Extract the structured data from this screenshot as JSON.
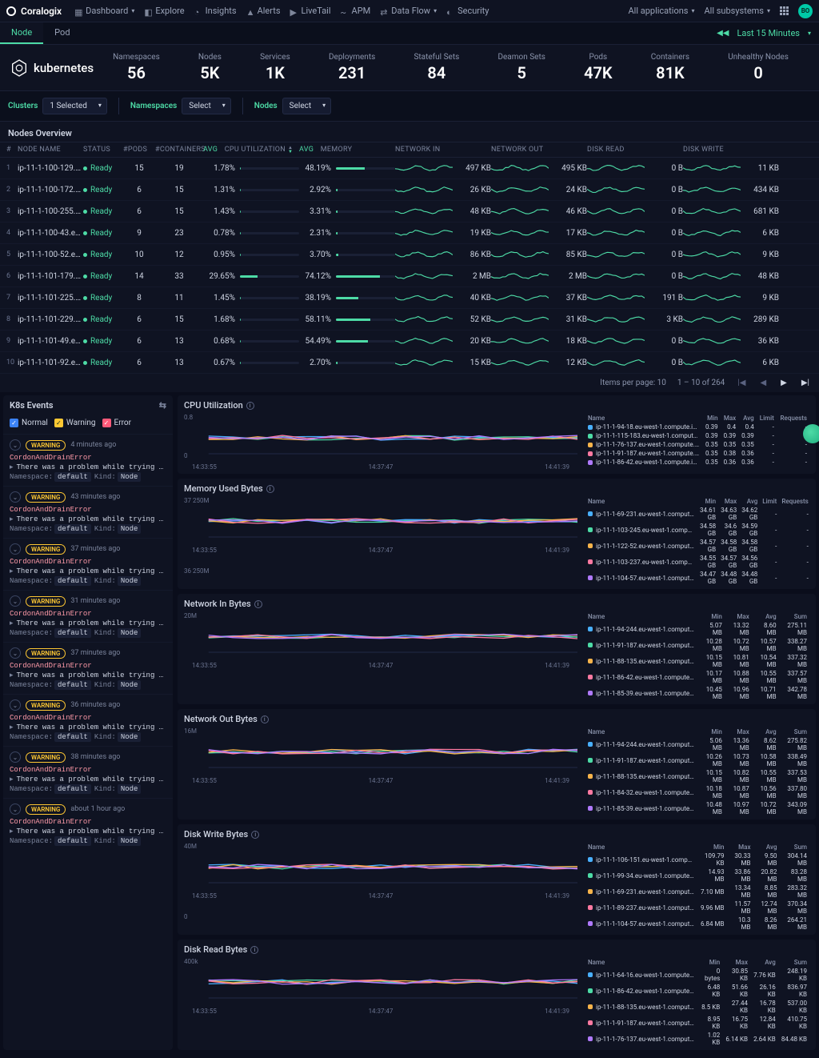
{
  "brand": "Coralogix",
  "nav": [
    {
      "label": "Dashboard",
      "caret": true
    },
    {
      "label": "Explore"
    },
    {
      "label": "Insights"
    },
    {
      "label": "Alerts"
    },
    {
      "label": "LiveTail"
    },
    {
      "label": "APM"
    },
    {
      "label": "Data Flow",
      "caret": true
    },
    {
      "label": "Security"
    }
  ],
  "nav_right": {
    "apps": "All applications",
    "subs": "All subsystems",
    "avatar": "BO"
  },
  "tabs": {
    "node": "Node",
    "pod": "Pod",
    "range": "Last 15 Minutes"
  },
  "product": "kubernetes",
  "stats": [
    {
      "label": "Namespaces",
      "value": "56"
    },
    {
      "label": "Nodes",
      "value": "5K"
    },
    {
      "label": "Services",
      "value": "1K"
    },
    {
      "label": "Deployments",
      "value": "231"
    },
    {
      "label": "Stateful Sets",
      "value": "84"
    },
    {
      "label": "Deamon Sets",
      "value": "5"
    },
    {
      "label": "Pods",
      "value": "47K"
    },
    {
      "label": "Containers",
      "value": "81K"
    },
    {
      "label": "Unhealthy Nodes",
      "value": "0"
    }
  ],
  "filters": {
    "clusters_label": "Clusters",
    "clusters_value": "1 Selected",
    "namespaces_label": "Namespaces",
    "namespaces_value": "Select",
    "nodes_label": "Nodes",
    "nodes_value": "Select"
  },
  "overview_title": "Nodes Overview",
  "columns": {
    "idx": "#",
    "name": "NODE NAME",
    "status": "STATUS",
    "pods": "#PODS",
    "cont": "#CONTAINERS",
    "cpu": "CPU UTILIZATION",
    "mem": "MEMORY",
    "avg": "AVG",
    "nin": "NETWORK IN",
    "nout": "NETWORK OUT",
    "dread": "DISK READ",
    "dwrite": "DISK WRITE"
  },
  "rows": [
    {
      "i": "1",
      "name": "ip-11-1-100-129.e...",
      "status": "Ready",
      "pods": "15",
      "cont": "19",
      "cpu": "1.78%",
      "cpuw": 1.78,
      "mem": "48.19%",
      "memw": 48.19,
      "nin": "497 KB",
      "nout": "495 KB",
      "dr": "0 B",
      "dw": "11 KB"
    },
    {
      "i": "2",
      "name": "ip-11-1-100-172.e...",
      "status": "Ready",
      "pods": "6",
      "cont": "15",
      "cpu": "1.31%",
      "cpuw": 1.31,
      "mem": "2.92%",
      "memw": 2.92,
      "nin": "26 KB",
      "nout": "24 KB",
      "dr": "0 B",
      "dw": "434 KB"
    },
    {
      "i": "3",
      "name": "ip-11-1-100-255.e...",
      "status": "Ready",
      "pods": "6",
      "cont": "15",
      "cpu": "1.43%",
      "cpuw": 1.43,
      "mem": "3.31%",
      "memw": 3.31,
      "nin": "48 KB",
      "nout": "46 KB",
      "dr": "0 B",
      "dw": "681 KB"
    },
    {
      "i": "4",
      "name": "ip-11-1-100-43.eu-...",
      "status": "Ready",
      "pods": "9",
      "cont": "23",
      "cpu": "0.78%",
      "cpuw": 0.78,
      "mem": "2.31%",
      "memw": 2.31,
      "nin": "19 KB",
      "nout": "17 KB",
      "dr": "0 B",
      "dw": "6 KB"
    },
    {
      "i": "5",
      "name": "ip-11-1-100-52.eu-...",
      "status": "Ready",
      "pods": "10",
      "cont": "12",
      "cpu": "0.95%",
      "cpuw": 0.95,
      "mem": "3.70%",
      "memw": 3.7,
      "nin": "86 KB",
      "nout": "85 KB",
      "dr": "0 B",
      "dw": "9 KB"
    },
    {
      "i": "6",
      "name": "ip-11-1-101-179.e...",
      "status": "Ready",
      "pods": "14",
      "cont": "33",
      "cpu": "29.65%",
      "cpuw": 29.65,
      "mem": "74.12%",
      "memw": 74.12,
      "nin": "2 MB",
      "nout": "2 MB",
      "dr": "0 B",
      "dw": "48 KB"
    },
    {
      "i": "7",
      "name": "ip-11-1-101-225.e...",
      "status": "Ready",
      "pods": "8",
      "cont": "11",
      "cpu": "1.45%",
      "cpuw": 1.45,
      "mem": "38.19%",
      "memw": 38.19,
      "nin": "40 KB",
      "nout": "37 KB",
      "dr": "191 B",
      "dw": "9 KB"
    },
    {
      "i": "8",
      "name": "ip-11-1-101-229.e...",
      "status": "Ready",
      "pods": "6",
      "cont": "15",
      "cpu": "1.68%",
      "cpuw": 1.68,
      "mem": "58.11%",
      "memw": 58.11,
      "nin": "52 KB",
      "nout": "31 KB",
      "dr": "3 KB",
      "dw": "289 KB"
    },
    {
      "i": "9",
      "name": "ip-11-1-101-49.eu-...",
      "status": "Ready",
      "pods": "6",
      "cont": "13",
      "cpu": "0.68%",
      "cpuw": 0.68,
      "mem": "54.49%",
      "memw": 54.49,
      "nin": "20 KB",
      "nout": "18 KB",
      "dr": "0 B",
      "dw": "36 KB"
    },
    {
      "i": "10",
      "name": "ip-11-1-101-92.eu-...",
      "status": "Ready",
      "pods": "6",
      "cont": "13",
      "cpu": "0.67%",
      "cpuw": 0.67,
      "mem": "2.70%",
      "memw": 2.7,
      "nin": "15 KB",
      "nout": "12 KB",
      "dr": "0 B",
      "dw": "6 KB"
    }
  ],
  "pager": {
    "per_label": "Items per page:",
    "per_value": "10",
    "range": "1 – 10 of 264"
  },
  "events": {
    "title": "K8s Events",
    "legend": {
      "normal": "Normal",
      "warning": "Warning",
      "error": "Error"
    },
    "items": [
      {
        "age": "4 minutes ago"
      },
      {
        "age": "43 minutes ago"
      },
      {
        "age": "37 minutes ago"
      },
      {
        "age": "31 minutes ago"
      },
      {
        "age": "37 minutes ago"
      },
      {
        "age": "36 minutes ago"
      },
      {
        "age": "38 minutes ago"
      },
      {
        "age": "about 1 hour ago"
      }
    ],
    "badge": "WARNING",
    "ev_title": "CordonAndDrainError",
    "ev_desc": "There was a problem while trying to cordon and drain the m",
    "meta_ns_lbl": "Namespace:",
    "meta_ns_val": "default",
    "meta_kind_lbl": "Kind:",
    "meta_kind_val": "Node"
  },
  "chart_axis_x": [
    "14:33:55",
    "14:37:47",
    "14:41:39"
  ],
  "charts": [
    {
      "title": "CPU Utilization",
      "ymax": "0.8",
      "ymin": "0",
      "cols": [
        "Name",
        "Min",
        "Max",
        "Avg",
        "Limit",
        "Requests"
      ],
      "series": [
        {
          "c": "#49b0ff",
          "name": "ip-11-1-94-18.eu-west-1.compute.internal",
          "vals": [
            "0.39",
            "0.4",
            "0.4",
            "-",
            "-"
          ]
        },
        {
          "c": "#4ddba6",
          "name": "ip-11-1-115-183.eu-west-1.compute.internal",
          "vals": [
            "0.39",
            "0.39",
            "0.39",
            "-",
            "-"
          ]
        },
        {
          "c": "#f7b44b",
          "name": "ip-11-1-76-137.eu-west-1.compute.internal",
          "vals": [
            "0.35",
            "0.35",
            "0.35",
            "-",
            "-"
          ]
        },
        {
          "c": "#ff7aa2",
          "name": "ip-11-1-91-187.eu-west-1.compute.internal",
          "vals": [
            "0.35",
            "0.38",
            "0.36",
            "-",
            "-"
          ]
        },
        {
          "c": "#b07aff",
          "name": "ip-11-1-86-42.eu-west-1.compute.internal",
          "vals": [
            "0.35",
            "0.36",
            "0.36",
            "-",
            "-"
          ]
        }
      ]
    },
    {
      "title": "Memory Used Bytes",
      "ymax": "37 250M",
      "ymin": "36 250M",
      "cols": [
        "Name",
        "Min",
        "Max",
        "Avg",
        "Limit",
        "Requests"
      ],
      "series": [
        {
          "c": "#49b0ff",
          "name": "ip-11-1-69-231.eu-west-1.compute.internal",
          "vals": [
            "34.61 GB",
            "34.63 GB",
            "34.62 GB",
            "-",
            "-"
          ]
        },
        {
          "c": "#4ddba6",
          "name": "ip-11-1-103-245.eu-west-1.compute.internal",
          "vals": [
            "34.58 GB",
            "34.6 GB",
            "34.59 GB",
            "-",
            "-"
          ]
        },
        {
          "c": "#f7b44b",
          "name": "ip-11-1-122-52.eu-west-1.compute.internal",
          "vals": [
            "34.57 GB",
            "34.58 GB",
            "34.58 GB",
            "-",
            "-"
          ]
        },
        {
          "c": "#ff7aa2",
          "name": "ip-11-1-103-237.eu-west-1.compute.internal",
          "vals": [
            "34.55 GB",
            "34.57 GB",
            "34.56 GB",
            "-",
            "-"
          ]
        },
        {
          "c": "#b07aff",
          "name": "ip-11-1-104-57.eu-west-1.compute.internal",
          "vals": [
            "34.47 GB",
            "34.48 GB",
            "34.48 GB",
            "-",
            "-"
          ]
        }
      ]
    },
    {
      "title": "Network In Bytes",
      "ymax": "20M",
      "ymin": "",
      "cols": [
        "Name",
        "Min",
        "Max",
        "Avg",
        "Sum"
      ],
      "series": [
        {
          "c": "#49b0ff",
          "name": "ip-11-1-94-244.eu-west-1.compute.internal",
          "vals": [
            "5.07 MB",
            "13.32 MB",
            "8.60 MB",
            "275.11 MB"
          ]
        },
        {
          "c": "#4ddba6",
          "name": "ip-11-1-91-187.eu-west-1.compute.internal",
          "vals": [
            "10.28 MB",
            "10.72 MB",
            "10.57 MB",
            "338.27 MB"
          ]
        },
        {
          "c": "#f7b44b",
          "name": "ip-11-1-88-135.eu-west-1.compute.internal",
          "vals": [
            "10.15 MB",
            "10.81 MB",
            "10.54 MB",
            "337.32 MB"
          ]
        },
        {
          "c": "#ff7aa2",
          "name": "ip-11-1-86-42.eu-west-1.compute.internal",
          "vals": [
            "10.17 MB",
            "10.88 MB",
            "10.55 MB",
            "337.57 MB"
          ]
        },
        {
          "c": "#b07aff",
          "name": "ip-11-1-85-39.eu-west-1.compute.internal",
          "vals": [
            "10.45 MB",
            "10.96 MB",
            "10.71 MB",
            "342.78 MB"
          ]
        }
      ]
    },
    {
      "title": "Network Out Bytes",
      "ymax": "16M",
      "ymin": "",
      "cols": [
        "Name",
        "Min",
        "Max",
        "Avg",
        "Sum"
      ],
      "series": [
        {
          "c": "#49b0ff",
          "name": "ip-11-1-94-244.eu-west-1.compute.internal",
          "vals": [
            "5.06 MB",
            "13.36 MB",
            "8.62 MB",
            "275.82 MB"
          ]
        },
        {
          "c": "#4ddba6",
          "name": "ip-11-1-91-187.eu-west-1.compute.internal",
          "vals": [
            "10.26 MB",
            "10.73 MB",
            "10.58 MB",
            "338.49 MB"
          ]
        },
        {
          "c": "#f7b44b",
          "name": "ip-11-1-88-135.eu-west-1.compute.internal",
          "vals": [
            "10.15 MB",
            "10.82 MB",
            "10.55 MB",
            "337.53 MB"
          ]
        },
        {
          "c": "#ff7aa2",
          "name": "ip-11-1-84-32.eu-west-1.compute.internal",
          "vals": [
            "10.18 MB",
            "10.87 MB",
            "10.56 MB",
            "337.80 MB"
          ]
        },
        {
          "c": "#b07aff",
          "name": "ip-11-1-85-39.eu-west-1.compute.internal",
          "vals": [
            "10.48 MB",
            "10.97 MB",
            "10.72 MB",
            "343.09 MB"
          ]
        }
      ]
    },
    {
      "title": "Disk Write Bytes",
      "ymax": "40M",
      "ymin": "0",
      "cols": [
        "Name",
        "Min",
        "Max",
        "Avg",
        "Sum"
      ],
      "series": [
        {
          "c": "#49b0ff",
          "name": "ip-11-1-106-151.eu-west-1.compute.internal",
          "vals": [
            "109.79 KB",
            "30.33 MB",
            "9.50 MB",
            "304.14 MB"
          ]
        },
        {
          "c": "#4ddba6",
          "name": "ip-11-1-99-34.eu-west-1.compute.internal",
          "vals": [
            "14.93 MB",
            "33.86 MB",
            "20.82 MB",
            "83.28 MB"
          ]
        },
        {
          "c": "#f7b44b",
          "name": "ip-11-1-69-231.eu-west-1.compute.internal",
          "vals": [
            "7.10 MB",
            "13.34 MB",
            "8.85 MB",
            "283.32 MB"
          ]
        },
        {
          "c": "#ff7aa2",
          "name": "ip-11-1-89-237.eu-west-1.compute.internal",
          "vals": [
            "9.96 MB",
            "11.57 MB",
            "12.74 MB",
            "370.34 MB"
          ]
        },
        {
          "c": "#b07aff",
          "name": "ip-11-1-104-57.eu-west-1.compute.internal",
          "vals": [
            "6.84 MB",
            "10.3 MB",
            "8.26 MB",
            "264.21 MB"
          ]
        }
      ]
    },
    {
      "title": "Disk Read Bytes",
      "ymax": "400k",
      "ymin": "",
      "cols": [
        "Name",
        "Min",
        "Max",
        "Avg",
        "Sum"
      ],
      "series": [
        {
          "c": "#49b0ff",
          "name": "ip-11-1-64-16.eu-west-1.compute.internal",
          "vals": [
            "0 bytes",
            "30.85 KB",
            "7.76 KB",
            "248.19 KB"
          ]
        },
        {
          "c": "#4ddba6",
          "name": "ip-11-1-86-42.eu-west-1.compute.internal",
          "vals": [
            "6.48 KB",
            "51.66 KB",
            "26.16 KB",
            "836.97 KB"
          ]
        },
        {
          "c": "#f7b44b",
          "name": "ip-11-1-88-135.eu-west-1.compute.internal",
          "vals": [
            "8.5 KB",
            "27.44 KB",
            "16.78 KB",
            "537.00 KB"
          ]
        },
        {
          "c": "#ff7aa2",
          "name": "ip-11-1-91-187.eu-west-1.compute.internal",
          "vals": [
            "8.95 KB",
            "16.75 KB",
            "12.84 KB",
            "410.75 KB"
          ]
        },
        {
          "c": "#b07aff",
          "name": "ip-11-1-76-137.eu-west-1.compute.internal",
          "vals": [
            "1.02 KB",
            "6.14 KB",
            "2.64 KB",
            "84.48 KB"
          ]
        }
      ]
    }
  ],
  "chart_data": [
    {
      "type": "line",
      "title": "CPU Utilization",
      "x": [
        "14:33:55",
        "14:37:47",
        "14:41:39"
      ],
      "ylim": [
        0,
        0.8
      ],
      "series": [
        {
          "name": "ip-11-1-94-18",
          "values": [
            0.4,
            0.4,
            0.39
          ]
        },
        {
          "name": "ip-11-1-115-183",
          "values": [
            0.39,
            0.39,
            0.39
          ]
        },
        {
          "name": "ip-11-1-76-137",
          "values": [
            0.35,
            0.35,
            0.35
          ]
        },
        {
          "name": "ip-11-1-91-187",
          "values": [
            0.36,
            0.38,
            0.35
          ]
        },
        {
          "name": "ip-11-1-86-42",
          "values": [
            0.36,
            0.36,
            0.35
          ]
        }
      ]
    },
    {
      "type": "line",
      "title": "Memory Used Bytes",
      "x": [
        "14:33:55",
        "14:37:47",
        "14:41:39"
      ],
      "ylim": [
        36250,
        37250
      ],
      "series": [
        {
          "name": "ip-11-1-69-231",
          "values": [
            34.62,
            34.63,
            34.61
          ]
        },
        {
          "name": "ip-11-1-103-245",
          "values": [
            34.59,
            34.6,
            34.58
          ]
        },
        {
          "name": "ip-11-1-122-52",
          "values": [
            34.58,
            34.58,
            34.57
          ]
        },
        {
          "name": "ip-11-1-103-237",
          "values": [
            34.56,
            34.57,
            34.55
          ]
        },
        {
          "name": "ip-11-1-104-57",
          "values": [
            34.48,
            34.48,
            34.47
          ]
        }
      ]
    },
    {
      "type": "line",
      "title": "Network In Bytes",
      "x": [
        "14:33:55",
        "14:37:47",
        "14:41:39"
      ],
      "ylim": [
        0,
        20
      ],
      "series": [
        {
          "name": "ip-11-1-94-244",
          "values": [
            5.07,
            8.6,
            13.32
          ]
        },
        {
          "name": "ip-11-1-91-187",
          "values": [
            10.28,
            10.57,
            10.72
          ]
        },
        {
          "name": "ip-11-1-88-135",
          "values": [
            10.15,
            10.54,
            10.81
          ]
        },
        {
          "name": "ip-11-1-86-42",
          "values": [
            10.17,
            10.55,
            10.88
          ]
        },
        {
          "name": "ip-11-1-85-39",
          "values": [
            10.45,
            10.71,
            10.96
          ]
        }
      ]
    },
    {
      "type": "line",
      "title": "Network Out Bytes",
      "x": [
        "14:33:55",
        "14:37:47",
        "14:41:39"
      ],
      "ylim": [
        0,
        16
      ],
      "series": [
        {
          "name": "ip-11-1-94-244",
          "values": [
            5.06,
            8.62,
            13.36
          ]
        },
        {
          "name": "ip-11-1-91-187",
          "values": [
            10.26,
            10.58,
            10.73
          ]
        },
        {
          "name": "ip-11-1-88-135",
          "values": [
            10.15,
            10.55,
            10.82
          ]
        },
        {
          "name": "ip-11-1-84-32",
          "values": [
            10.18,
            10.56,
            10.87
          ]
        },
        {
          "name": "ip-11-1-85-39",
          "values": [
            10.48,
            10.72,
            10.97
          ]
        }
      ]
    },
    {
      "type": "line",
      "title": "Disk Write Bytes",
      "x": [
        "14:33:55",
        "14:37:47",
        "14:41:39"
      ],
      "ylim": [
        0,
        40
      ],
      "series": [
        {
          "name": "ip-11-1-106-151",
          "values": [
            30.33,
            9.5,
            0.11
          ]
        },
        {
          "name": "ip-11-1-99-34",
          "values": [
            33.86,
            20.82,
            14.93
          ]
        },
        {
          "name": "ip-11-1-69-231",
          "values": [
            13.34,
            8.85,
            7.1
          ]
        },
        {
          "name": "ip-11-1-89-237",
          "values": [
            11.57,
            12.74,
            9.96
          ]
        },
        {
          "name": "ip-11-1-104-57",
          "values": [
            10.3,
            8.26,
            6.84
          ]
        }
      ]
    },
    {
      "type": "line",
      "title": "Disk Read Bytes",
      "x": [
        "14:33:55",
        "14:37:47",
        "14:41:39"
      ],
      "ylim": [
        0,
        400
      ],
      "series": [
        {
          "name": "ip-11-1-64-16",
          "values": [
            0,
            7.76,
            30.85
          ]
        },
        {
          "name": "ip-11-1-86-42",
          "values": [
            6.48,
            26.16,
            51.66
          ]
        },
        {
          "name": "ip-11-1-88-135",
          "values": [
            8.5,
            16.78,
            27.44
          ]
        },
        {
          "name": "ip-11-1-91-187",
          "values": [
            8.95,
            12.84,
            16.75
          ]
        },
        {
          "name": "ip-11-1-76-137",
          "values": [
            1.02,
            2.64,
            6.14
          ]
        }
      ]
    }
  ]
}
